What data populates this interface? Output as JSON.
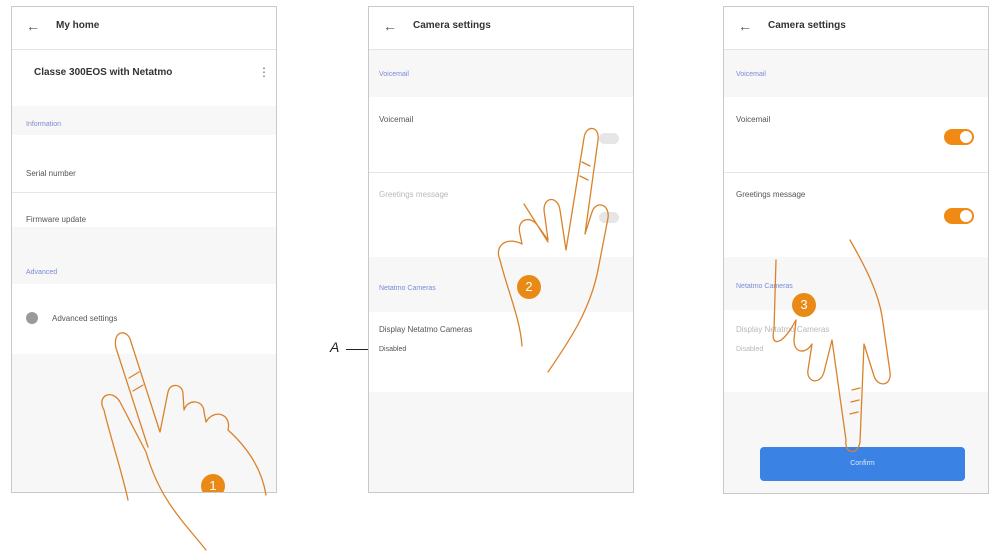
{
  "screen1": {
    "back_icon": "arrow-left-icon",
    "title": "My home",
    "device_name": "Classe 300EOS with Netatmo",
    "menu_icon": "kebab-icon",
    "section_info": "Information",
    "serial_label": "Serial number",
    "serial_value": "",
    "firmware_label": "Firmware update",
    "firmware_value": "",
    "section_advanced": "Advanced",
    "advanced_settings": "Advanced settings",
    "step": "1"
  },
  "screen2": {
    "back_icon": "arrow-left-icon",
    "title": "Camera settings",
    "section1": "Voicemail",
    "voicemail_label": "Voicemail",
    "voicemail_desc": "",
    "greetings_label": "Greetings message",
    "greetings_desc": "",
    "section2": "Netatmo Cameras",
    "display_label": "Display Netatmo Cameras",
    "display_sub": "Disabled",
    "display_desc": "",
    "step": "2",
    "callout": "A"
  },
  "screen3": {
    "back_icon": "arrow-left-icon",
    "title": "Camera settings",
    "section1": "Voicemail",
    "voicemail_label": "Voicemail",
    "voicemail_desc": "",
    "greetings_label": "Greetings message",
    "greetings_desc": "",
    "section2": "Netatmo Cameras",
    "display_label": "Display Netatmo Cameras",
    "display_sub": "Disabled",
    "confirm_label": "Confirm",
    "step": "3"
  },
  "colors": {
    "accent": "#e98a17",
    "toggle_on": "#f08a14",
    "button": "#3a82e4",
    "section": "#7a8ad8"
  }
}
